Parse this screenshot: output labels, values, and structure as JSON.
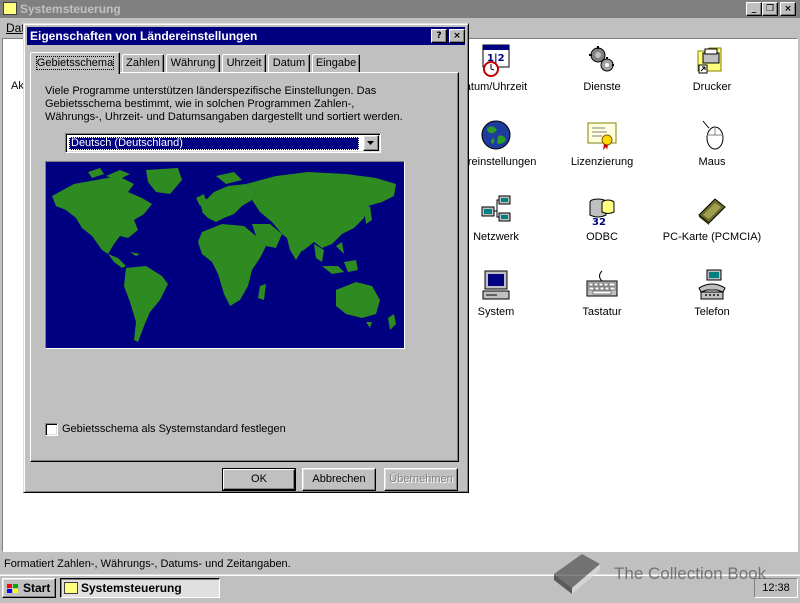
{
  "main_window": {
    "title": "Systemsteuerung",
    "menu_first": "Dat",
    "left_cut_label": "Ak",
    "status": "Formatiert Zahlen-, Währungs-, Datums- und Zeitangaben."
  },
  "control_panel_items": [
    {
      "label": "atum/Uhrzeit",
      "icon": "calendar-clock-icon"
    },
    {
      "label": "Dienste",
      "icon": "services-icon"
    },
    {
      "label": "Drucker",
      "icon": "printer-folder-icon"
    },
    {
      "label": "dereinstellungen",
      "icon": "globe-icon"
    },
    {
      "label": "Lizenzierung",
      "icon": "certificate-icon"
    },
    {
      "label": "Maus",
      "icon": "mouse-icon"
    },
    {
      "label": "Netzwerk",
      "icon": "network-icon"
    },
    {
      "label": "ODBC",
      "icon": "odbc-icon"
    },
    {
      "label": "PC-Karte (PCMCIA)",
      "icon": "pc-card-icon"
    },
    {
      "label": "System",
      "icon": "computer-icon"
    },
    {
      "label": "Tastatur",
      "icon": "keyboard-icon"
    },
    {
      "label": "Telefon",
      "icon": "telephone-icon"
    }
  ],
  "dialog": {
    "title": "Eigenschaften von Ländereinstellungen",
    "help_btn": "?",
    "close_btn": "×",
    "tabs": [
      "Gebietsschema",
      "Zahlen",
      "Währung",
      "Uhrzeit",
      "Datum",
      "Eingabe"
    ],
    "description": "Viele Programme unterstützen länderspezifische Einstellungen. Das Gebietsschema bestimmt, wie in solchen Programmen Zahlen-, Währungs-, Uhrzeit- und Datumsangaben dargestellt und sortiert werden.",
    "locale": "Deutsch (Deutschland)",
    "checkbox_label": "Gebietsschema als Systemstandard festlegen",
    "checkbox_checked": false,
    "buttons": {
      "ok": "OK",
      "cancel": "Abbrechen",
      "apply": "Übernehmen"
    }
  },
  "taskbar": {
    "start": "Start",
    "task": "Systemsteuerung",
    "clock": "12:38"
  },
  "watermark": "The Collection Book",
  "colors": {
    "title_active": "#000080",
    "title_inactive": "#808080",
    "face": "#c0c0c0",
    "map_sea": "#000080",
    "map_land": "#2e8b22"
  }
}
